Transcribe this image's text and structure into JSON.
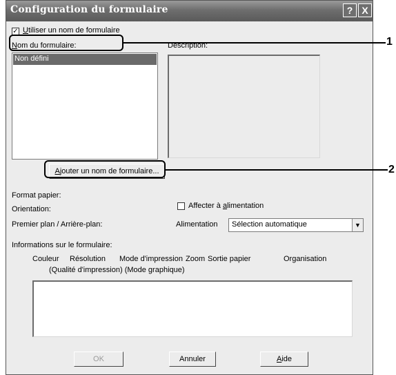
{
  "window": {
    "title": "Configuration du formulaire",
    "help_button": "?",
    "close_button": "X"
  },
  "use_form_name": {
    "checked": true,
    "label_prefix": "",
    "label_access": "U",
    "label_rest": "tiliser un nom de formulaire"
  },
  "form_names": {
    "label_access": "N",
    "label_rest": "om du formulaire:",
    "items": [
      "Non défini"
    ],
    "selected_index": 0
  },
  "description": {
    "label": "Description:"
  },
  "add_form_button": {
    "access": "A",
    "rest": "jouter un nom de formulaire..."
  },
  "fields": {
    "format_papier": "Format papier:",
    "orientation": "Orientation:",
    "premier_plan": "Premier plan / Arrière-plan:"
  },
  "assign_feed": {
    "checked": false,
    "label_pre": "Affecter à ",
    "label_access": "a",
    "label_rest": "limentation"
  },
  "source": {
    "label": "Alimentation",
    "value": "Sélection automatique"
  },
  "form_info": {
    "label": "Informations sur le formulaire:",
    "columns_line1": [
      "Couleur",
      "Résolution",
      "Mode d'impression",
      "Zoom",
      "Sortie papier",
      "Organisation"
    ],
    "columns_line2": "(Qualité d'impression) (Mode graphique)"
  },
  "buttons": {
    "ok": "OK",
    "cancel": "Annuler",
    "help_access": "A",
    "help_rest": "ide"
  },
  "callouts": [
    "1",
    "2"
  ]
}
